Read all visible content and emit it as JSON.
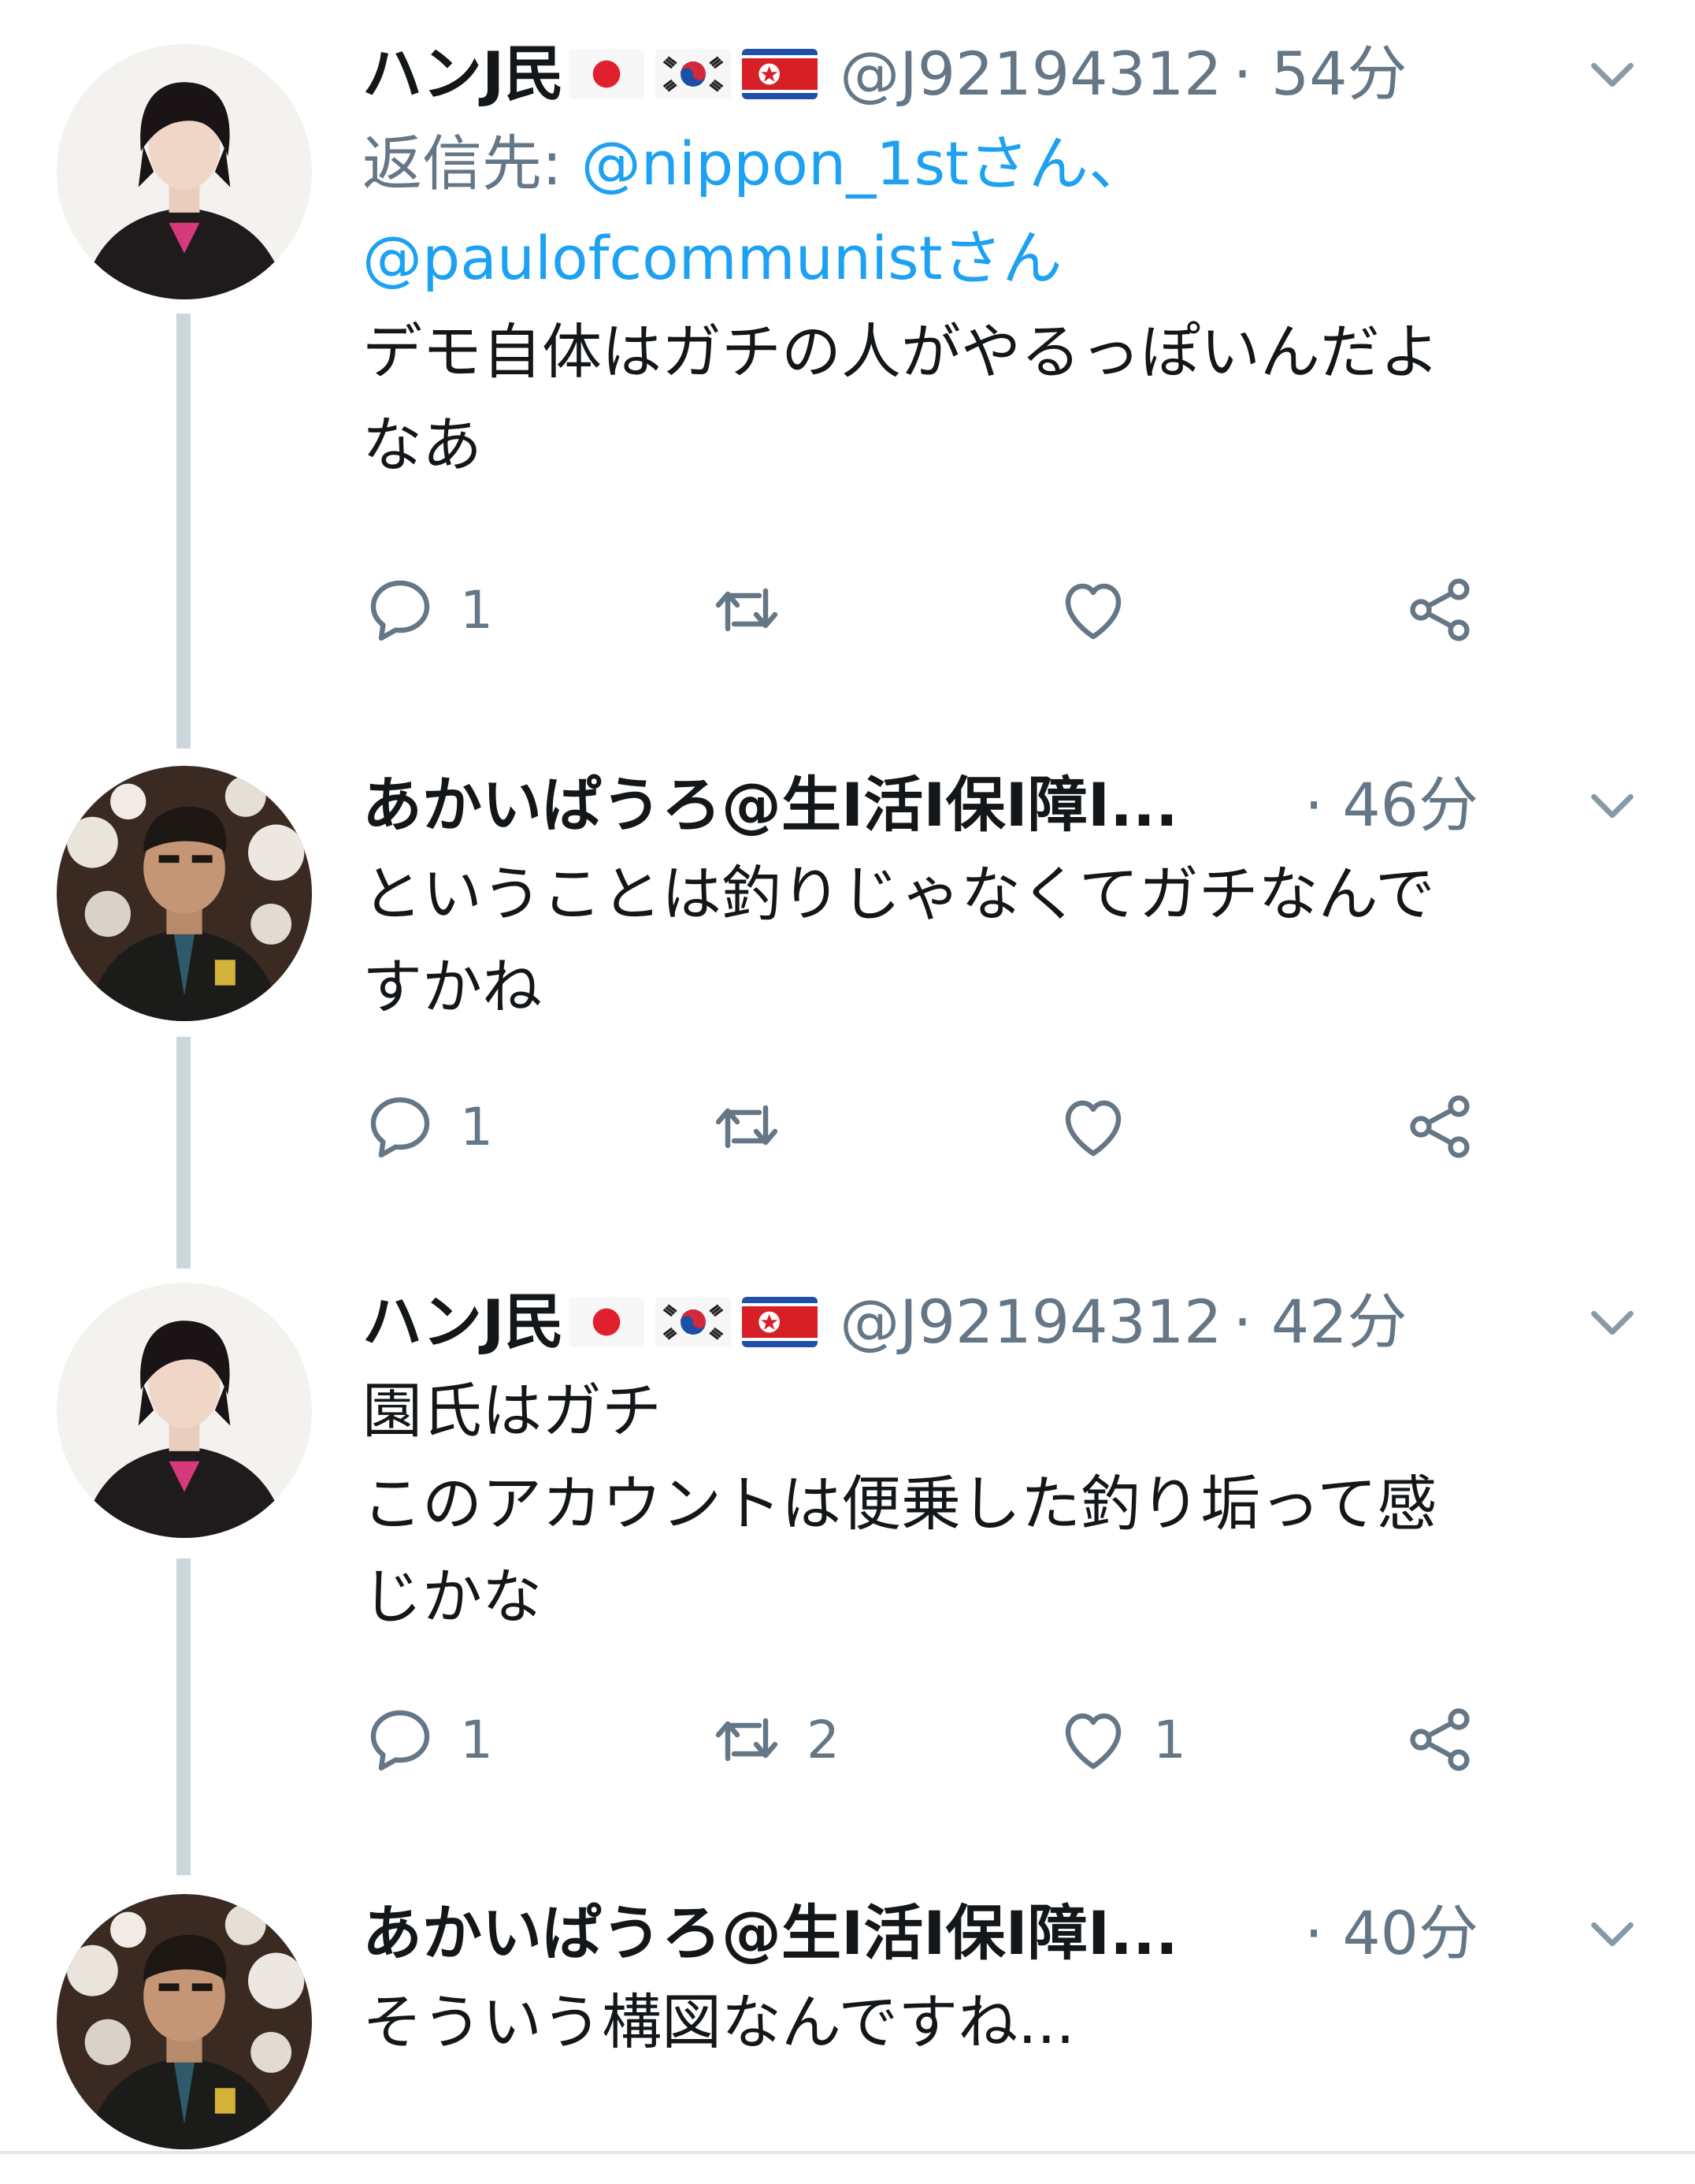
{
  "tweets": [
    {
      "name": "ハンJ民",
      "flags": [
        "japan-flag",
        "south-korea-flag",
        "north-korea-flag"
      ],
      "handle": "@J92194312",
      "time": "· 54分",
      "reply_label": "返信先: ",
      "reply_mentions": [
        "@nippon_1stさん、",
        "@paulofcommunistさん"
      ],
      "text": "デモ自体はガチの人がやるっぽいんだよ\nなあ",
      "reply_count": "1",
      "retweet_count": "",
      "like_count": ""
    },
    {
      "name": "あかいぱうろ@生I活I保I障I...",
      "flags": [],
      "handle": "",
      "time": "· 46分",
      "text": "ということは釣りじゃなくてガチなんで\nすかね",
      "reply_count": "1",
      "retweet_count": "",
      "like_count": ""
    },
    {
      "name": "ハンJ民",
      "flags": [
        "japan-flag",
        "south-korea-flag",
        "north-korea-flag"
      ],
      "handle": "@J92194312",
      "time": "· 42分",
      "text": "園氏はガチ\nこのアカウントは便乗した釣り垢って感\nじかな",
      "reply_count": "1",
      "retweet_count": "2",
      "like_count": "1"
    },
    {
      "name": "あかいぱうろ@生I活I保I障I...",
      "flags": [],
      "handle": "",
      "time": "· 40分",
      "text": "そういう構図なんですね..."
    }
  ]
}
